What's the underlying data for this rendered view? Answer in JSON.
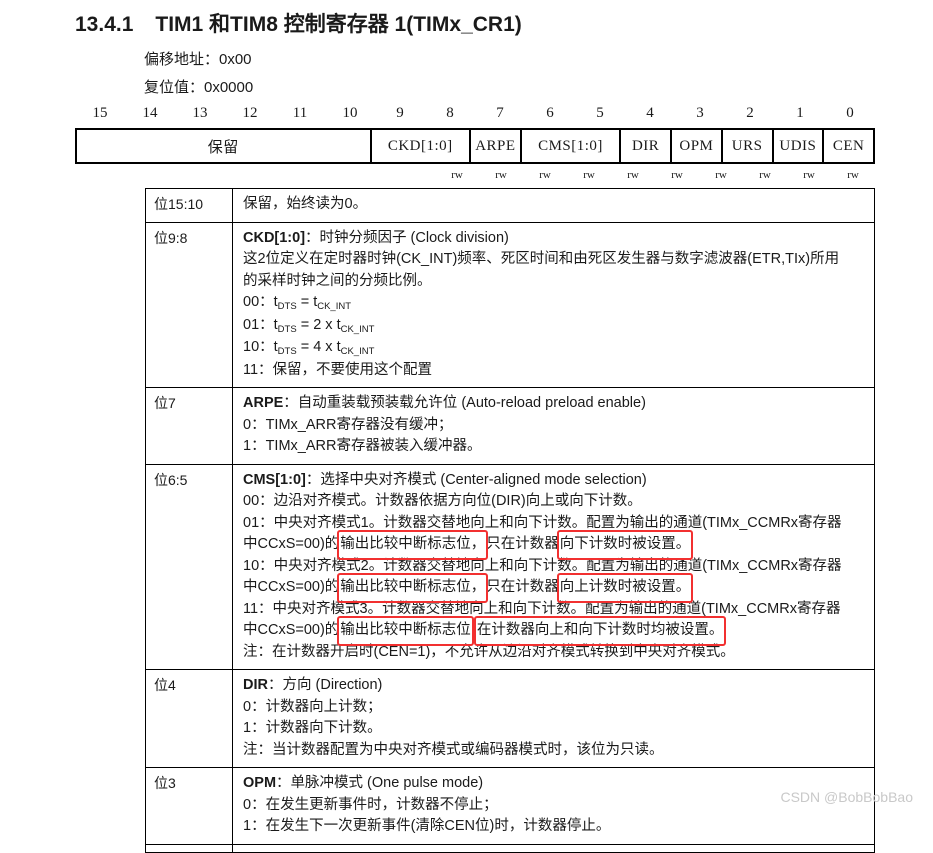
{
  "heading": {
    "number": "13.4.1",
    "title": "TIM1 和TIM8 控制寄存器 1(TIMx_CR1)"
  },
  "meta": {
    "offset": "偏移地址：0x00",
    "reset": "复位值：0x0000"
  },
  "register": {
    "bit_numbers": [
      "15",
      "14",
      "13",
      "12",
      "11",
      "10",
      "9",
      "8",
      "7",
      "6",
      "5",
      "4",
      "3",
      "2",
      "1",
      "0"
    ],
    "fields": [
      {
        "label": "保留",
        "span": 6
      },
      {
        "label": "CKD[1:0]",
        "span": 2
      },
      {
        "label": "ARPE",
        "span": 1
      },
      {
        "label": "CMS[1:0]",
        "span": 2
      },
      {
        "label": "DIR",
        "span": 1
      },
      {
        "label": "OPM",
        "span": 1
      },
      {
        "label": "URS",
        "span": 1
      },
      {
        "label": "UDIS",
        "span": 1
      },
      {
        "label": "CEN",
        "span": 1
      }
    ],
    "access": [
      "rw",
      "rw",
      "rw",
      "rw",
      "rw",
      "rw",
      "rw",
      "rw",
      "rw",
      "rw"
    ]
  },
  "rows": {
    "r0": {
      "bits": "位15:10",
      "line1": "保留，始终读为0。"
    },
    "r1": {
      "bits": "位9:8",
      "name": "CKD[1:0]",
      "colon": "：",
      "desc": "时钟分频因子 (Clock division)",
      "para1": "这2位定义在定时器时钟(CK_INT)频率、死区时间和由死区发生器与数字滤波器(ETR,TIx)所用",
      "para2": "的采样时钟之间的分频比例。",
      "v00_prefix": "00：t",
      "v00_sub1": "DTS",
      "v00_mid": " = t",
      "v00_sub2": "CK_INT",
      "v01_prefix": "01：t",
      "v01_sub1": "DTS",
      "v01_mid": " = 2 x t",
      "v01_sub2": "CK_INT",
      "v10_prefix": "10：t",
      "v10_sub1": "DTS",
      "v10_mid": " = 4 x t",
      "v10_sub2": "CK_INT",
      "v11": "11：保留，不要使用这个配置"
    },
    "r2": {
      "bits": "位7",
      "name": "ARPE",
      "colon": "：",
      "desc": "自动重装载预装载允许位 (Auto-reload preload enable)",
      "v0": "0：TIMx_ARR寄存器没有缓冲；",
      "v1": "1：TIMx_ARR寄存器被装入缓冲器。"
    },
    "r3": {
      "bits": "位6:5",
      "name": "CMS[1:0]",
      "colon": "：",
      "desc": "选择中央对齐模式 (Center-aligned mode selection)",
      "v00": "00：边沿对齐模式。计数器依据方向位(DIR)向上或向下计数。",
      "v01_a": "01：中央对齐模式1。计数器交替地向上和向下计数。配置为输出的通道(TIMx_CCMRx寄存器",
      "v01_b1": "中CCxS=00)的",
      "v01_hl1": "输出比较中断标志位，",
      "v01_b2": "只在计数器",
      "v01_hl2": "向下计数时被设置。",
      "v10_a": "10：中央对齐模式2。计数器交替地向上和向下计数。配置为输出的通道(TIMx_CCMRx寄存器",
      "v10_b1": "中CCxS=00)的",
      "v10_hl1": "输出比较中断标志位，",
      "v10_b2": "只在计数器",
      "v10_hl2": "向上计数时被设置。",
      "v11_a": "11：中央对齐模式3。计数器交替地向上和向下计数。配置为输出的通道(TIMx_CCMRx寄存器",
      "v11_b1": "中CCxS=00)的",
      "v11_hl1": "输出比较中断标志位",
      "v11_gap": " ",
      "v11_hl2": "在计数器向上和向下计数时均被设置。",
      "note": "注：在计数器开启时(CEN=1)，不允许从边沿对齐模式转换到中央对齐模式。"
    },
    "r4": {
      "bits": "位4",
      "name": "DIR",
      "colon": "：",
      "desc": "方向 (Direction)",
      "v0": "0：计数器向上计数；",
      "v1": "1：计数器向下计数。",
      "note": "注：当计数器配置为中央对齐模式或编码器模式时，该位为只读。"
    },
    "r5": {
      "bits": "位3",
      "name": "OPM",
      "colon": "：",
      "desc": "单脉冲模式 (One pulse mode)",
      "v0": "0：在发生更新事件时，计数器不停止；",
      "v1": "1：在发生下一次更新事件(清除CEN位)时，计数器停止。"
    }
  },
  "watermark": "CSDN @BobBobBao",
  "colors": {
    "highlight": "#f23030",
    "watermark": "#c9c9c9",
    "border": "#000000"
  }
}
